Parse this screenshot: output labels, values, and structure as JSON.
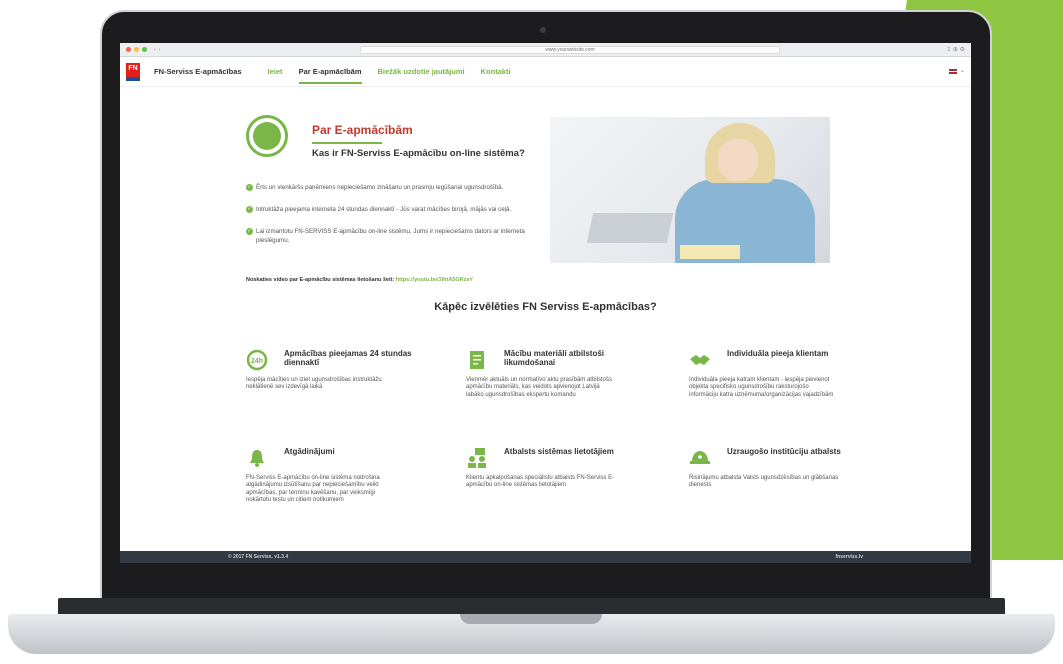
{
  "browser": {
    "url": "www.yourwebsite.com"
  },
  "nav": {
    "logo": "FN",
    "brand": "FN-Serviss E-apmācības",
    "links": [
      "Ieiet",
      "Par E-apmācībām",
      "Biežāk uzdotie jautājumi",
      "Kontakti"
    ],
    "active": "Par E-apmācībām"
  },
  "about": {
    "title": "Par E-apmācībām",
    "subtitle": "Kas ir FN-Serviss E-apmācību on-line sistēma?",
    "bullets": [
      "Ērts un vienkāršs paņēmiens nepieciešamo zināšanu un prasmju iegūšanai ugunsdrošībā.",
      "Intruktāža pieejama interneta 24 stundas diennaktī - Jūs varat mācīties birojā, mājās vai ceļā.",
      "Lai izmantotu FN-SERVISS E-apmācību on-line sistēmu, Jums ir nepieciešams dators ar interneta pieslēgumu."
    ],
    "video_label": "Noskaties video par E-apmācību sistēmas lietošanu šeit:",
    "video_link": "https://youtu.be/3lhtA5GRzsY"
  },
  "why_title": "Kāpēc izvēlēties FN Serviss E-apmācības?",
  "features": [
    {
      "title": "Apmācības pieejamas 24 stundas diennaktī",
      "icon": "clock-24h-icon",
      "desc": "Iespēja mācīties un iziet ugunsdrošības instruktāžu neklātienē sev izdevīgā laikā"
    },
    {
      "title": "Mācību materiāli atbilstoši likumdošanai",
      "icon": "document-icon",
      "desc": "Vienmēr aktuāls un normatīvo aktu prasībām atbilstošs apmācību materiāls, kas veidots apvienojot Latvijā labāko ugunsdrošības ekspertu komandu"
    },
    {
      "title": "Individuāla pieeja klientam",
      "icon": "handshake-icon",
      "desc": "Individuāla pieeja katram klientam - iespēja pievienot objekta specifisko ugunsdrošību raksturojošo informāciju katra uzņēmuma/organizācijas vajadzībām"
    },
    {
      "title": "Atgādinājumi",
      "icon": "bell-icon",
      "desc": "FN-Serviss E-apmācību on-line sistēma nodrošina atgādinājumu izsūtīšanu par nepieciešamību veikt apmācības, par termiņu kavēšanu, par veiksmīgi nokārtotu testu un citiem notikumiem"
    },
    {
      "title": "Atbalsts sistēmas lietotājiem",
      "icon": "support-icon",
      "desc": "Klientu apkalpošanas speciālistu atbalsts FN-Serviss E-apmācību on-line sistēmas lietotājiem"
    },
    {
      "title": "Uzraugošo institūciju atbalsts",
      "icon": "helmet-icon",
      "desc": "Risinājumu atbalsta Valsts ugunsdzēsības un glābšanas dienests"
    }
  ],
  "footer": {
    "left": "© 2017 FN Serviss. v1.3.4",
    "right": "fnserviss.lv"
  },
  "colors": {
    "accent": "#7ab648",
    "title_red": "#c0392b",
    "footer": "#333a44",
    "bg_green": "#8ec641"
  }
}
